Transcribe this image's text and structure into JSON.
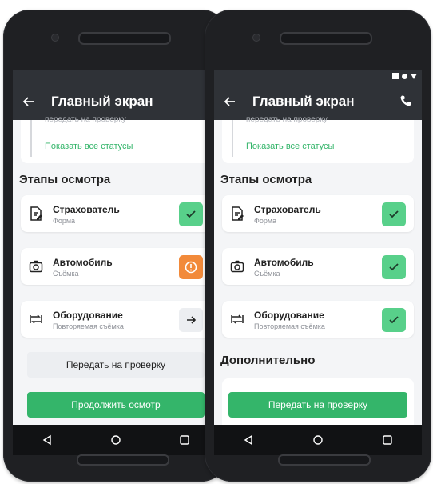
{
  "colors": {
    "appbar": "#2f3237",
    "green": "#34b56a",
    "success_badge": "#58d08a",
    "warning_badge": "#f28a3a"
  },
  "left": {
    "title": "Главный экран",
    "faded_status": "передать на проверку",
    "show_all": "Показать все статусы",
    "section": "Этапы осмотра",
    "items": [
      {
        "title": "Страхователь",
        "subtitle": "Форма",
        "icon": "form-icon",
        "state": "check-icon"
      },
      {
        "title": "Автомобиль",
        "subtitle": "Съёмка",
        "icon": "camera-icon",
        "state": "warning-icon"
      },
      {
        "title": "Оборудование",
        "subtitle": "Повторяемая съёмка",
        "icon": "repeat-icon",
        "state": "arrow-right-icon"
      }
    ],
    "secondary_button": "Передать на проверку",
    "primary_button": "Продолжить осмотр"
  },
  "right": {
    "title": "Главный экран",
    "faded_status": "передать на проверку",
    "show_all": "Показать все статусы",
    "section": "Этапы осмотра",
    "items": [
      {
        "title": "Страхователь",
        "subtitle": "Форма",
        "icon": "form-icon",
        "state": "check-icon"
      },
      {
        "title": "Автомобиль",
        "subtitle": "Съёмка",
        "icon": "camera-icon",
        "state": "check-icon"
      },
      {
        "title": "Оборудование",
        "subtitle": "Повторяемая съёмка",
        "icon": "repeat-icon",
        "state": "check-icon"
      }
    ],
    "extra_section": "Дополнительно",
    "primary_button": "Передать на проверку"
  }
}
